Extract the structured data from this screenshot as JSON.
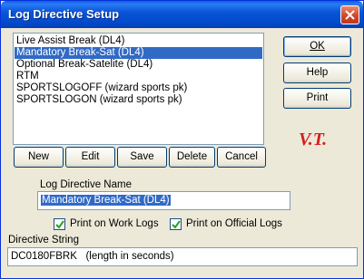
{
  "window": {
    "title": "Log Directive Setup"
  },
  "list": {
    "items": [
      {
        "label": "Live Assist Break (DL4)",
        "selected": false
      },
      {
        "label": "Mandatory Break-Sat (DL4)",
        "selected": true
      },
      {
        "label": "Optional Break-Satelite  (DL4)",
        "selected": false
      },
      {
        "label": "RTM",
        "selected": false
      },
      {
        "label": "SPORTSLOGOFF  (wizard sports pk)",
        "selected": false
      },
      {
        "label": "SPORTSLOGON  (wizard sports pk)",
        "selected": false
      }
    ]
  },
  "side_buttons": {
    "ok": "OK",
    "help": "Help",
    "print": "Print"
  },
  "logo": {
    "text": "V.T.",
    "color": "#d81e1e"
  },
  "action_buttons": {
    "new": "New",
    "edit": "Edit",
    "save": "Save",
    "delete": "Delete",
    "cancel": "Cancel"
  },
  "name_field": {
    "label": "Log Directive Name",
    "value": "Mandatory Break-Sat (DL4)"
  },
  "checkboxes": {
    "work_logs": {
      "label": "Print on Work Logs",
      "checked": true
    },
    "official_logs": {
      "label": "Print on Official Logs",
      "checked": true
    }
  },
  "directive_field": {
    "label": "Directive String",
    "value": "DC0180FBRK   (length in seconds)"
  },
  "colors": {
    "selection": "#316ac5",
    "titlebar": "#0a56d8",
    "window_bg": "#ece9d8"
  }
}
